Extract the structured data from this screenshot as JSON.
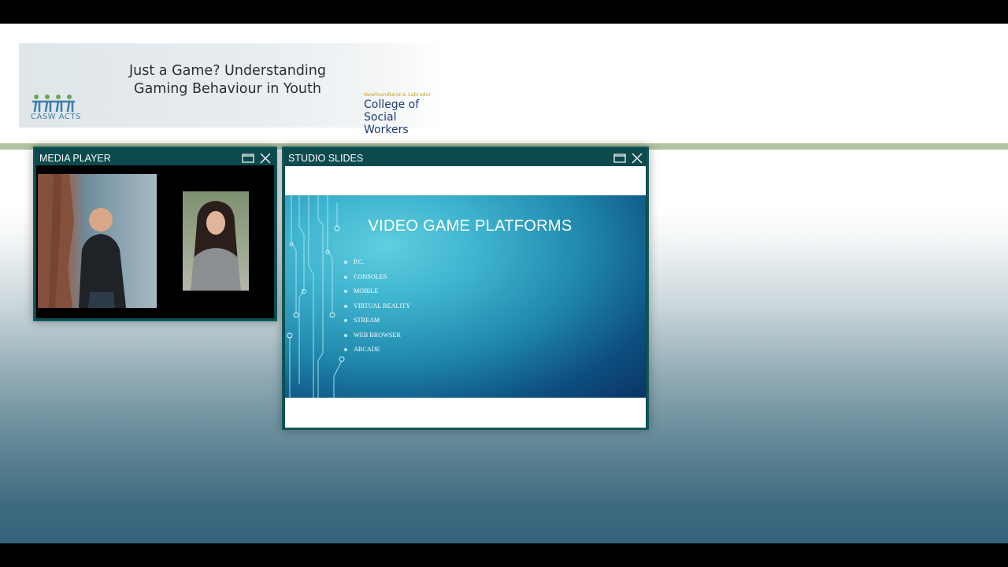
{
  "banner": {
    "title_line1": "Just a Game? Understanding",
    "title_line2": "Gaming Behaviour in Youth",
    "casw_label": "CASW ACTS",
    "college_small": "Newfoundland & Labrador",
    "college_line1": "College of",
    "college_line2": "Social Workers"
  },
  "media_player": {
    "title": "MEDIA PLAYER"
  },
  "studio_slides": {
    "title": "STUDIO SLIDES",
    "slide_title": "VIDEO GAME PLATFORMS",
    "bullets": [
      "P.C.",
      "CONSOLES",
      "MOBILE",
      "VIRTUAL REALITY",
      "STREAM",
      "WEB BROWSER",
      "ARCADE"
    ]
  },
  "icons": {
    "maximize": "maximize-icon",
    "close": "close-icon"
  },
  "colors": {
    "window_frame": "#0d4a4d",
    "accent_rule": "#b3c2a0",
    "college_blue": "#1c3c78",
    "casw_green": "#6aa84f",
    "casw_blue": "#3f7fa6"
  }
}
